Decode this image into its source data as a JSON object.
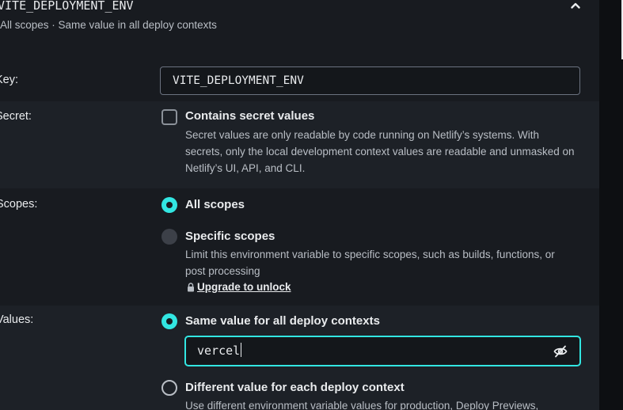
{
  "header": {
    "title": "VITE_DEPLOYMENT_ENV",
    "subtitle": "All scopes  ·  Same value in all deploy contexts",
    "collapse_icon": "chevron-up-icon"
  },
  "key_row": {
    "label": "Key:",
    "value": "VITE_DEPLOYMENT_ENV"
  },
  "secret_row": {
    "label": "Secret:",
    "checkbox_checked": false,
    "title": "Contains secret values",
    "description": "Secret values are only readable by code running on Netlify’s systems. With secrets, only the local development context values are readable and unmasked on Netlify’s UI, API, and CLI."
  },
  "scopes_row": {
    "label": "Scopes:",
    "options": [
      {
        "title": "All scopes",
        "selected": true
      },
      {
        "title": "Specific scopes",
        "selected": false,
        "disabled": true,
        "description": "Limit this environment variable to specific scopes, such as builds, functions, or post processing",
        "upgrade_link": "Upgrade to unlock",
        "upgrade_icon": "lock-icon"
      }
    ]
  },
  "values_row": {
    "label": "Values:",
    "options": [
      {
        "title": "Same value for all deploy contexts",
        "selected": true
      },
      {
        "title": "Different value for each deploy context",
        "selected": false,
        "description": "Use different environment variable values for production, Deploy Previews,"
      }
    ],
    "value_input": "vercel",
    "toggle_icon": "eye-slash-icon"
  },
  "colors": {
    "accent": "#32e6e2",
    "background": "#181b20",
    "row_alt": "#1d2127",
    "text": "#e9ebed",
    "muted_text": "#b9bec5"
  }
}
